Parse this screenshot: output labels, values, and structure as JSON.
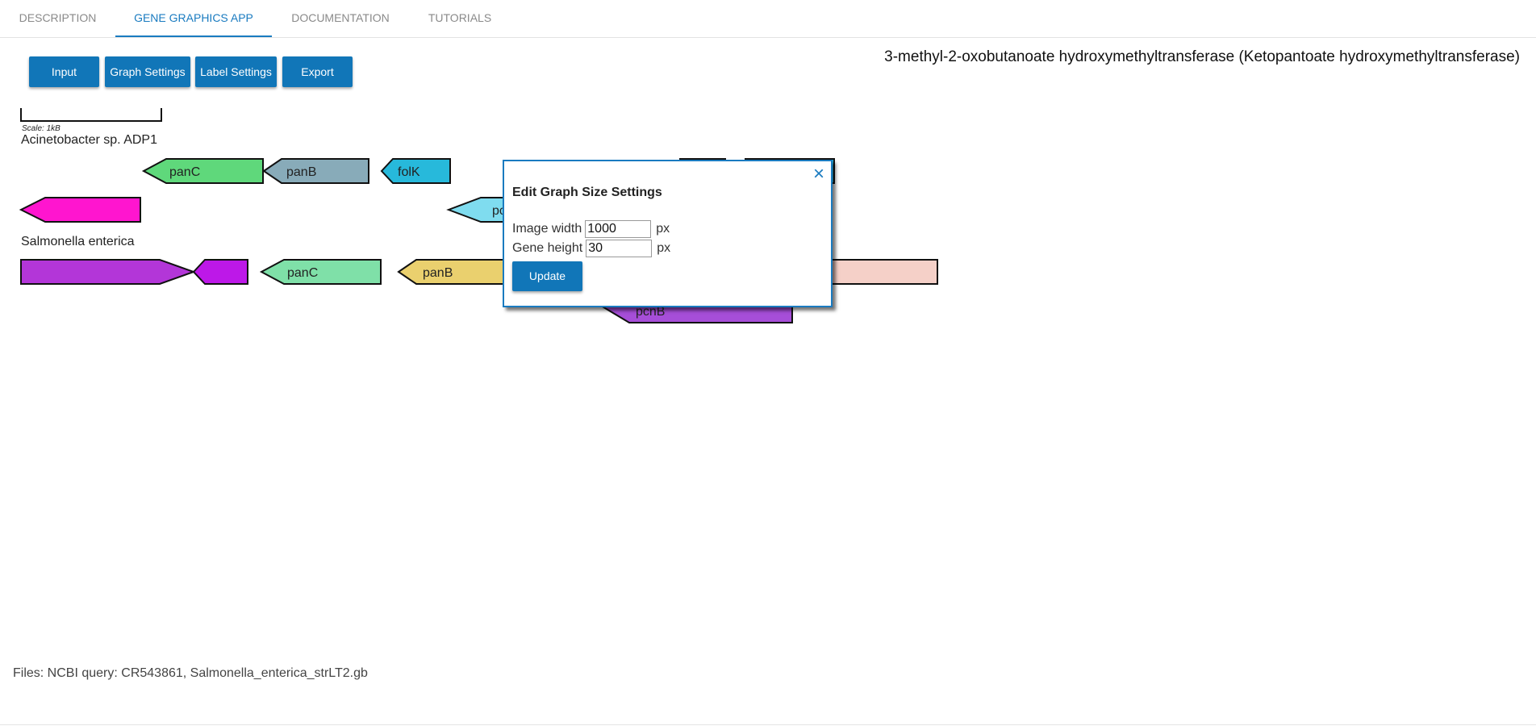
{
  "tabs": [
    {
      "label": "DESCRIPTION",
      "active": false
    },
    {
      "label": "GENE GRAPHICS APP",
      "active": true
    },
    {
      "label": "DOCUMENTATION",
      "active": false
    },
    {
      "label": "TUTORIALS",
      "active": false
    }
  ],
  "toolbar": {
    "input_label": "Input",
    "graph_settings_label": "Graph Settings",
    "label_settings_label": "Label Settings",
    "export_label": "Export"
  },
  "page_title": "3-methyl-2-oxobutanoate hydroxymethyltransferase (Ketopantoate hydroxymethyltransferase)",
  "scale_label": "Scale: 1kB",
  "genomes": [
    {
      "name": "Acinetobacter sp. ADP1",
      "genes": [
        {
          "label": "panC",
          "color": "#5fd87b"
        },
        {
          "label": "panB",
          "color": "#88abb9"
        },
        {
          "label": "folK",
          "color": "#27b9db"
        },
        {
          "label": "",
          "color": "#ff15cf"
        },
        {
          "label": "pc",
          "color": "#7fdcef"
        }
      ]
    },
    {
      "name": "Salmonella enterica",
      "genes": [
        {
          "label": "",
          "color": "#b336d8"
        },
        {
          "label": "",
          "color": "#bd18e8"
        },
        {
          "label": "panC",
          "color": "#7fe0a8"
        },
        {
          "label": "panB",
          "color": "#ead06e"
        },
        {
          "label": "",
          "color": "#f5d0c8"
        },
        {
          "label": "pcnB",
          "color": "#a64ed8"
        }
      ]
    }
  ],
  "footer": {
    "files_text": "Files: NCBI query: CR543861, Salmonella_enterica_strLT2.gb"
  },
  "modal": {
    "title": "Edit Graph Size Settings",
    "close_glyph": "×",
    "image_width_label": "Image width",
    "image_width_value": "1000",
    "gene_height_label": "Gene height",
    "gene_height_value": "30",
    "unit": "px",
    "update_label": "Update"
  },
  "colors": {
    "accent": "#1a7bc0",
    "button": "#1176b8"
  }
}
